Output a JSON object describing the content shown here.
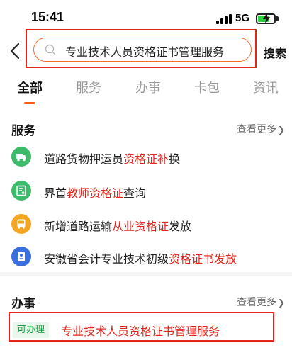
{
  "status_bar": {
    "time": "15:41",
    "network": "5G",
    "battery_level": 0.7
  },
  "search": {
    "back_icon": "chevron-left-icon",
    "query": "专业技术人员资格证书管理服务",
    "search_button": "搜索"
  },
  "tabs": [
    {
      "label": "全部",
      "active": true
    },
    {
      "label": "服务",
      "active": false
    },
    {
      "label": "办事",
      "active": false
    },
    {
      "label": "卡包",
      "active": false
    },
    {
      "label": "资讯",
      "active": false
    }
  ],
  "services_section": {
    "title": "服务",
    "more": "查看更多",
    "items": [
      {
        "icon": "truck-icon",
        "icon_color": "#3dba6a",
        "prefix": "道路货物押运员",
        "highlight": "资格证补",
        "suffix": "换"
      },
      {
        "icon": "certificate-icon",
        "icon_color": "#3dba6a",
        "prefix": "界首",
        "highlight": "教师资格证",
        "suffix": "查询"
      },
      {
        "icon": "bus-icon",
        "icon_color": "#f4a623",
        "prefix": "新增道路运输",
        "highlight": "从业资格证",
        "suffix": "发放"
      },
      {
        "icon": "id-card-icon",
        "icon_color": "#3a6fe0",
        "prefix": "安徽省会计专业技术初级",
        "highlight": "资格证书发放",
        "suffix": ""
      }
    ]
  },
  "tasks_section": {
    "title": "办事",
    "more": "查看更多",
    "items": [
      {
        "badge": "可办理",
        "label": "专业技术人员资格证书管理服务"
      }
    ]
  },
  "colors": {
    "accent_orange": "#ff5a1f",
    "highlight_red": "#e1251b",
    "badge_green": "#21a045"
  }
}
